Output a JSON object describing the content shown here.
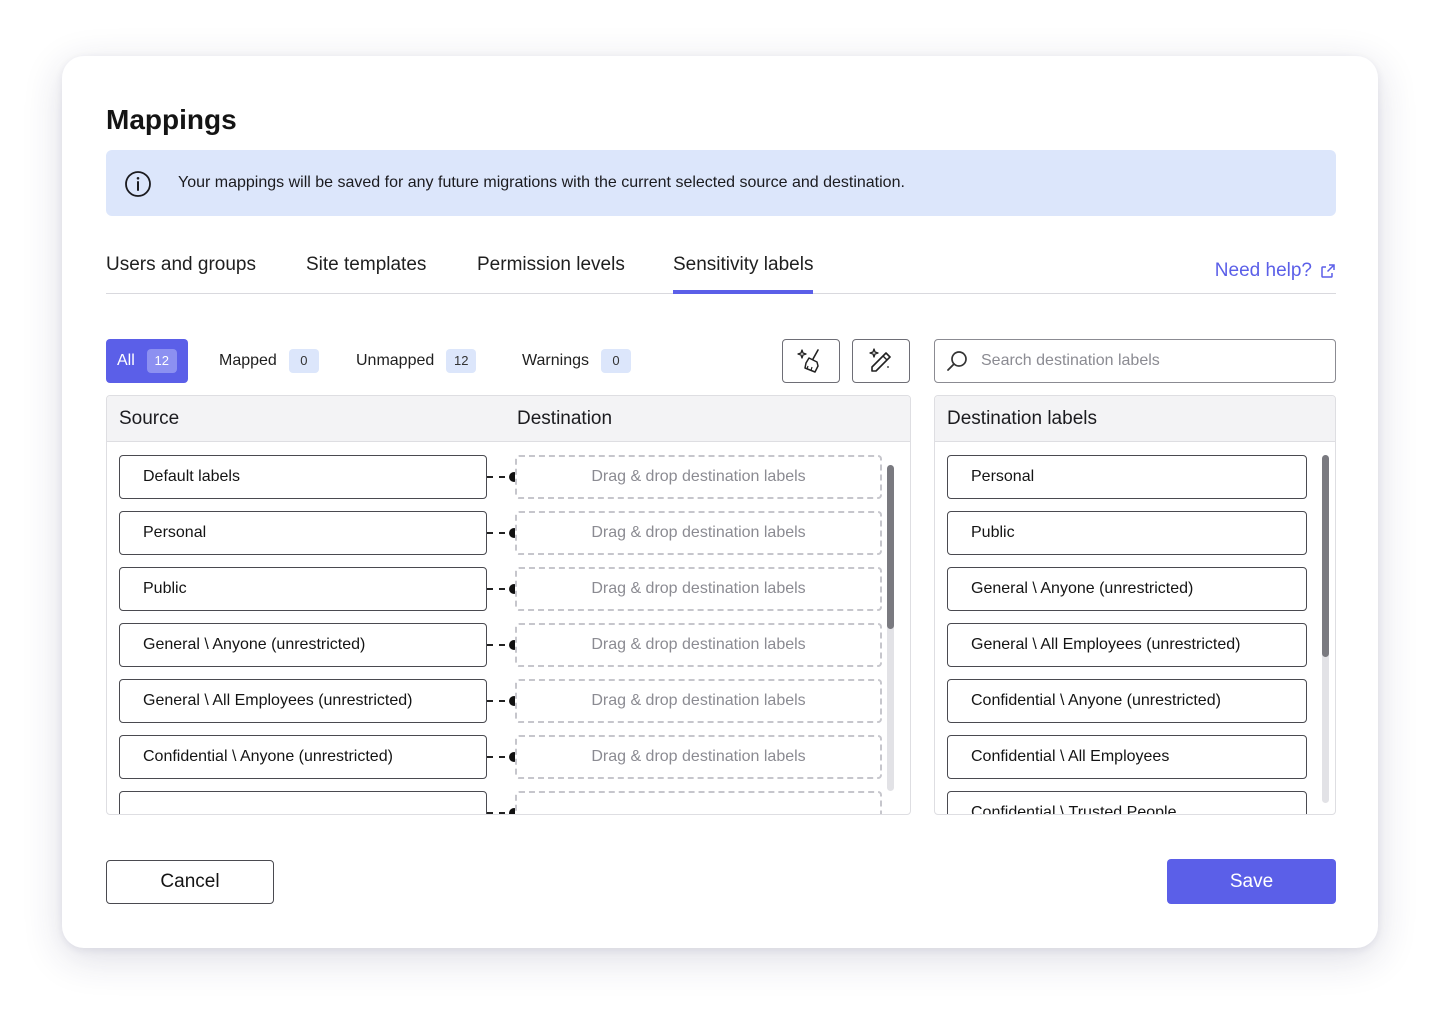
{
  "dialog": {
    "title": "Mappings",
    "banner": {
      "icon": "info-icon",
      "text": "Your mappings will be saved for any future migrations with the current selected source and destination."
    },
    "tabs": [
      {
        "label": "Users and groups",
        "active": false
      },
      {
        "label": "Site templates",
        "active": false
      },
      {
        "label": "Permission levels",
        "active": false
      },
      {
        "label": "Sensitivity labels",
        "active": true
      }
    ],
    "help": {
      "label": "Need help?",
      "icon": "external-link-icon"
    },
    "filters": [
      {
        "label": "All",
        "count": "12",
        "active": true
      },
      {
        "label": "Mapped",
        "count": "0",
        "active": false
      },
      {
        "label": "Unmapped",
        "count": "12",
        "active": false
      },
      {
        "label": "Warnings",
        "count": "0",
        "active": false
      }
    ],
    "tools": [
      {
        "icon": "sparkle-broom-icon",
        "name": "clear-mappings-button"
      },
      {
        "icon": "magic-wand-icon",
        "name": "auto-map-button"
      }
    ],
    "search": {
      "placeholder": "Search destination labels",
      "value": ""
    },
    "mapping_table": {
      "source_header": "Source",
      "destination_header": "Destination",
      "drop_placeholder": "Drag & drop destination labels",
      "rows": [
        {
          "source": "Default labels"
        },
        {
          "source": "Personal"
        },
        {
          "source": "Public"
        },
        {
          "source": "General \\ Anyone (unrestricted)"
        },
        {
          "source": "General \\ All Employees (unrestricted)"
        },
        {
          "source": "Confidential \\ Anyone (unrestricted)"
        },
        {
          "source": ""
        }
      ]
    },
    "destination_panel": {
      "header": "Destination labels",
      "items": [
        "Personal",
        "Public",
        "General \\ Anyone (unrestricted)",
        "General \\ All Employees (unrestricted)",
        "Confidential \\ Anyone (unrestricted)",
        "Confidential \\ All Employees",
        "Confidential \\ Trusted People"
      ]
    },
    "footer": {
      "cancel_label": "Cancel",
      "save_label": "Save"
    },
    "colors": {
      "accent": "#5b5fe8",
      "banner_bg": "#dce6fb"
    }
  }
}
